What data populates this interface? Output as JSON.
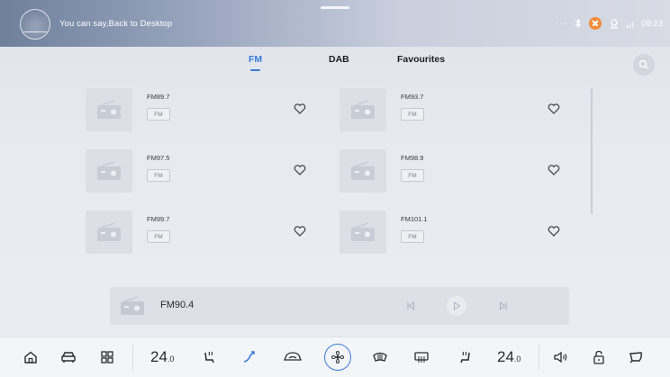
{
  "status_bar": {
    "voice_hint": "You can say,Back to Desktop",
    "overflow_icon": "more-dots-icon",
    "time": "09:23",
    "colors": {
      "no_signal": "#f28a3a"
    }
  },
  "tabs": [
    {
      "label": "FM",
      "active": true
    },
    {
      "label": "DAB",
      "active": false
    },
    {
      "label": "Favourites",
      "active": false
    }
  ],
  "stations": [
    {
      "name": "FM89.7",
      "band": "FM"
    },
    {
      "name": "FM93.7",
      "band": "FM"
    },
    {
      "name": "FM97.5",
      "band": "FM"
    },
    {
      "name": "FM98.9",
      "band": "FM"
    },
    {
      "name": "FM99.7",
      "band": "FM"
    },
    {
      "name": "FM101.1",
      "band": "FM"
    }
  ],
  "now_playing": {
    "title": "FM90.4",
    "controls": [
      "previous-icon",
      "play-icon",
      "next-icon"
    ]
  },
  "climate": {
    "left_temp": "24",
    "left_temp_decimal": ".0",
    "right_temp": "24",
    "right_temp_decimal": ".0"
  },
  "accent_color": "#3a7bd5"
}
